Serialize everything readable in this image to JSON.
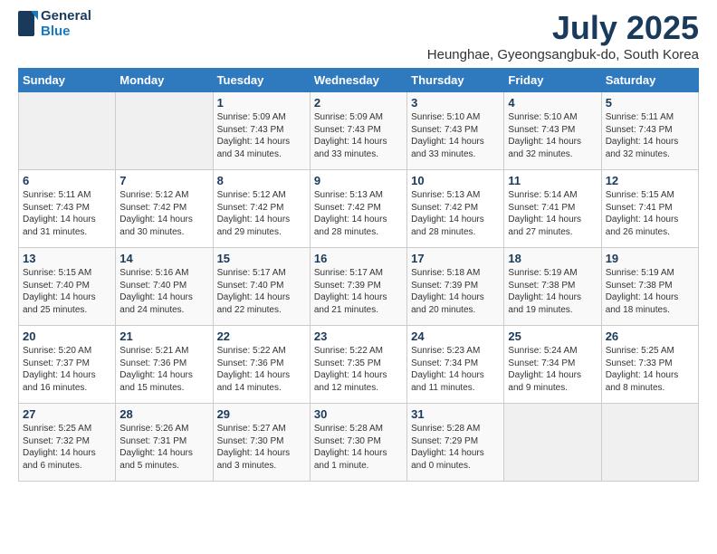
{
  "header": {
    "logo_line1": "General",
    "logo_line2": "Blue",
    "month": "July 2025",
    "location": "Heunghae, Gyeongsangbuk-do, South Korea"
  },
  "weekdays": [
    "Sunday",
    "Monday",
    "Tuesday",
    "Wednesday",
    "Thursday",
    "Friday",
    "Saturday"
  ],
  "weeks": [
    [
      {
        "day": "",
        "info": ""
      },
      {
        "day": "",
        "info": ""
      },
      {
        "day": "1",
        "info": "Sunrise: 5:09 AM\nSunset: 7:43 PM\nDaylight: 14 hours and 34 minutes."
      },
      {
        "day": "2",
        "info": "Sunrise: 5:09 AM\nSunset: 7:43 PM\nDaylight: 14 hours and 33 minutes."
      },
      {
        "day": "3",
        "info": "Sunrise: 5:10 AM\nSunset: 7:43 PM\nDaylight: 14 hours and 33 minutes."
      },
      {
        "day": "4",
        "info": "Sunrise: 5:10 AM\nSunset: 7:43 PM\nDaylight: 14 hours and 32 minutes."
      },
      {
        "day": "5",
        "info": "Sunrise: 5:11 AM\nSunset: 7:43 PM\nDaylight: 14 hours and 32 minutes."
      }
    ],
    [
      {
        "day": "6",
        "info": "Sunrise: 5:11 AM\nSunset: 7:43 PM\nDaylight: 14 hours and 31 minutes."
      },
      {
        "day": "7",
        "info": "Sunrise: 5:12 AM\nSunset: 7:42 PM\nDaylight: 14 hours and 30 minutes."
      },
      {
        "day": "8",
        "info": "Sunrise: 5:12 AM\nSunset: 7:42 PM\nDaylight: 14 hours and 29 minutes."
      },
      {
        "day": "9",
        "info": "Sunrise: 5:13 AM\nSunset: 7:42 PM\nDaylight: 14 hours and 28 minutes."
      },
      {
        "day": "10",
        "info": "Sunrise: 5:13 AM\nSunset: 7:42 PM\nDaylight: 14 hours and 28 minutes."
      },
      {
        "day": "11",
        "info": "Sunrise: 5:14 AM\nSunset: 7:41 PM\nDaylight: 14 hours and 27 minutes."
      },
      {
        "day": "12",
        "info": "Sunrise: 5:15 AM\nSunset: 7:41 PM\nDaylight: 14 hours and 26 minutes."
      }
    ],
    [
      {
        "day": "13",
        "info": "Sunrise: 5:15 AM\nSunset: 7:40 PM\nDaylight: 14 hours and 25 minutes."
      },
      {
        "day": "14",
        "info": "Sunrise: 5:16 AM\nSunset: 7:40 PM\nDaylight: 14 hours and 24 minutes."
      },
      {
        "day": "15",
        "info": "Sunrise: 5:17 AM\nSunset: 7:40 PM\nDaylight: 14 hours and 22 minutes."
      },
      {
        "day": "16",
        "info": "Sunrise: 5:17 AM\nSunset: 7:39 PM\nDaylight: 14 hours and 21 minutes."
      },
      {
        "day": "17",
        "info": "Sunrise: 5:18 AM\nSunset: 7:39 PM\nDaylight: 14 hours and 20 minutes."
      },
      {
        "day": "18",
        "info": "Sunrise: 5:19 AM\nSunset: 7:38 PM\nDaylight: 14 hours and 19 minutes."
      },
      {
        "day": "19",
        "info": "Sunrise: 5:19 AM\nSunset: 7:38 PM\nDaylight: 14 hours and 18 minutes."
      }
    ],
    [
      {
        "day": "20",
        "info": "Sunrise: 5:20 AM\nSunset: 7:37 PM\nDaylight: 14 hours and 16 minutes."
      },
      {
        "day": "21",
        "info": "Sunrise: 5:21 AM\nSunset: 7:36 PM\nDaylight: 14 hours and 15 minutes."
      },
      {
        "day": "22",
        "info": "Sunrise: 5:22 AM\nSunset: 7:36 PM\nDaylight: 14 hours and 14 minutes."
      },
      {
        "day": "23",
        "info": "Sunrise: 5:22 AM\nSunset: 7:35 PM\nDaylight: 14 hours and 12 minutes."
      },
      {
        "day": "24",
        "info": "Sunrise: 5:23 AM\nSunset: 7:34 PM\nDaylight: 14 hours and 11 minutes."
      },
      {
        "day": "25",
        "info": "Sunrise: 5:24 AM\nSunset: 7:34 PM\nDaylight: 14 hours and 9 minutes."
      },
      {
        "day": "26",
        "info": "Sunrise: 5:25 AM\nSunset: 7:33 PM\nDaylight: 14 hours and 8 minutes."
      }
    ],
    [
      {
        "day": "27",
        "info": "Sunrise: 5:25 AM\nSunset: 7:32 PM\nDaylight: 14 hours and 6 minutes."
      },
      {
        "day": "28",
        "info": "Sunrise: 5:26 AM\nSunset: 7:31 PM\nDaylight: 14 hours and 5 minutes."
      },
      {
        "day": "29",
        "info": "Sunrise: 5:27 AM\nSunset: 7:30 PM\nDaylight: 14 hours and 3 minutes."
      },
      {
        "day": "30",
        "info": "Sunrise: 5:28 AM\nSunset: 7:30 PM\nDaylight: 14 hours and 1 minute."
      },
      {
        "day": "31",
        "info": "Sunrise: 5:28 AM\nSunset: 7:29 PM\nDaylight: 14 hours and 0 minutes."
      },
      {
        "day": "",
        "info": ""
      },
      {
        "day": "",
        "info": ""
      }
    ]
  ]
}
